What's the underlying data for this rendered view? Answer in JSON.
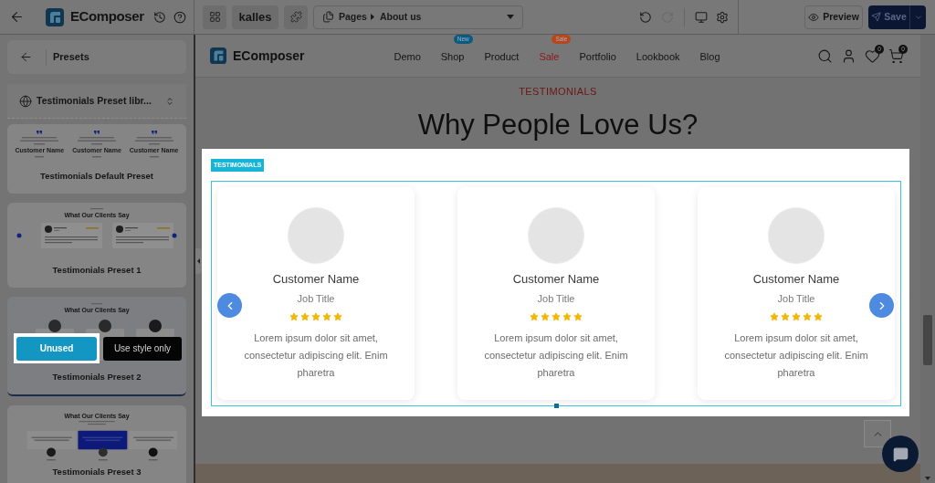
{
  "topbar": {
    "app_name": "EComposer",
    "theme_button": "kalles",
    "page_select": {
      "section": "Pages",
      "page": "About us"
    },
    "history": [
      {
        "kind": "undo",
        "disabled": false
      },
      {
        "kind": "redo",
        "disabled": true
      }
    ],
    "preview_button": "Preview",
    "save_button": "Save"
  },
  "sidebar": {
    "title": "Presets",
    "library_select": "Testimonials Preset libr...",
    "presets": [
      {
        "name": "Testimonials Default Preset",
        "kind": "quote-columns",
        "hovered": false,
        "thumbnail_names": [
          "Customer Name",
          "Customer Name",
          "Customer Name"
        ]
      },
      {
        "name": "Testimonials Preset 1",
        "kind": "slider-cards",
        "hovered": false,
        "thumbnail_heading": "What Our Clients Say"
      },
      {
        "name": "Testimonials Preset 2",
        "kind": "avatar-cards",
        "hovered": true,
        "thumbnail_heading": "What Our Clients Say",
        "actions": [
          {
            "label": "Unused",
            "kind": "primary",
            "highlighted": true
          },
          {
            "label": "Use style only",
            "kind": "secondary",
            "highlighted": false
          }
        ]
      },
      {
        "name": "Testimonials Preset 3",
        "kind": "boxed-quotes",
        "hovered": false,
        "thumbnail_heading": "What Our Clients Say"
      }
    ]
  },
  "canvas": {
    "header": {
      "logo": "EComposer",
      "nav": [
        {
          "label": "Demo",
          "color": "#141414"
        },
        {
          "label": "Shop",
          "color": "#141414",
          "badge": {
            "text": "New",
            "color": "#0d5a80"
          }
        },
        {
          "label": "Product",
          "color": "#141414"
        },
        {
          "label": "Sale",
          "color": "#8c1a1a",
          "badge": {
            "text": "Sale",
            "color": "#b8461c"
          }
        },
        {
          "label": "Portfolio",
          "color": "#141414"
        },
        {
          "label": "Lookbook",
          "color": "#141414"
        },
        {
          "label": "Blog",
          "color": "#141414"
        }
      ],
      "wishlist_count": "0",
      "cart_count": "0"
    },
    "section": {
      "eyebrow": "TESTIMONIALS",
      "heading": "Why People Love Us?"
    },
    "carousel": {
      "tag": "TESTIMONIALS",
      "spotlight": true,
      "cards": [
        {
          "name": "Customer Name",
          "job_title": "Job Title",
          "stars": 5,
          "text": "Lorem ipsum dolor sit amet, consectetur adipiscing elit. Enim pharetra"
        },
        {
          "name": "Customer Name",
          "job_title": "Job Title",
          "stars": 5,
          "text": "Lorem ipsum dolor sit amet, consectetur adipiscing elit. Enim pharetra"
        },
        {
          "name": "Customer Name",
          "job_title": "Job Title",
          "stars": 5,
          "text": "Lorem ipsum dolor sit amet, consectetur adipiscing elit. Enim pharetra"
        }
      ],
      "dots": [
        {
          "selected": true
        }
      ]
    }
  }
}
